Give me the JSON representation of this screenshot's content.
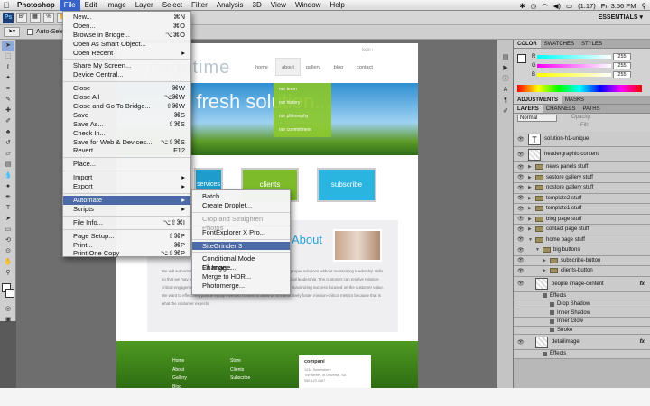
{
  "menubar": {
    "app": "Photoshop",
    "items": [
      "File",
      "Edit",
      "Image",
      "Layer",
      "Select",
      "Filter",
      "Analysis",
      "3D",
      "View",
      "Window",
      "Help"
    ],
    "battery": "(1:17)",
    "clock": "Fri 3:56 PM"
  },
  "appbar": {
    "essentials": "ESSENTIALS ▾",
    "auto_select": "Auto-Select"
  },
  "file_menu": [
    {
      "label": "New...",
      "sc": "⌘N"
    },
    {
      "label": "Open...",
      "sc": "⌘O"
    },
    {
      "label": "Browse in Bridge...",
      "sc": "⌥⌘O"
    },
    {
      "label": "Open As Smart Object...",
      "sc": ""
    },
    {
      "label": "Open Recent",
      "sc": "▸"
    },
    {
      "sep": true
    },
    {
      "label": "Share My Screen...",
      "sc": ""
    },
    {
      "label": "Device Central...",
      "sc": ""
    },
    {
      "sep": true
    },
    {
      "label": "Close",
      "sc": "⌘W"
    },
    {
      "label": "Close All",
      "sc": "⌥⌘W"
    },
    {
      "label": "Close and Go To Bridge...",
      "sc": "⇧⌘W"
    },
    {
      "label": "Save",
      "sc": "⌘S"
    },
    {
      "label": "Save As...",
      "sc": "⇧⌘S"
    },
    {
      "label": "Check In...",
      "sc": ""
    },
    {
      "label": "Save for Web & Devices...",
      "sc": "⌥⇧⌘S"
    },
    {
      "label": "Revert",
      "sc": "F12"
    },
    {
      "sep": true
    },
    {
      "label": "Place...",
      "sc": ""
    },
    {
      "sep": true
    },
    {
      "label": "Import",
      "sc": "▸"
    },
    {
      "label": "Export",
      "sc": "▸"
    },
    {
      "sep": true
    },
    {
      "label": "Automate",
      "sc": "▸",
      "hl": true
    },
    {
      "label": "Scripts",
      "sc": "▸"
    },
    {
      "sep": true
    },
    {
      "label": "File Info...",
      "sc": "⌥⇧⌘I"
    },
    {
      "sep": true
    },
    {
      "label": "Page Setup...",
      "sc": "⇧⌘P"
    },
    {
      "label": "Print...",
      "sc": "⌘P"
    },
    {
      "label": "Print One Copy",
      "sc": "⌥⇧⌘P"
    }
  ],
  "automate_menu": [
    {
      "label": "Batch..."
    },
    {
      "label": "Create Droplet..."
    },
    {
      "sep": true
    },
    {
      "label": "Crop and Straighten Photos",
      "dis": true
    },
    {
      "sep": true
    },
    {
      "label": "FontExplorer X Pro..."
    },
    {
      "sep": true
    },
    {
      "label": "SiteGrinder 3",
      "hl": true
    },
    {
      "sep": true
    },
    {
      "label": "Conditional Mode Change..."
    },
    {
      "label": "Fit Image..."
    },
    {
      "label": "Merge to HDR..."
    },
    {
      "label": "Photomerge..."
    }
  ],
  "doc": {
    "logo": "pagetime",
    "nav": [
      "home",
      "about",
      "gallery",
      "blog",
      "contact"
    ],
    "hero": "a fresh solution...",
    "dropdown": [
      "our team",
      "our history",
      "our philosophy",
      "our commitment"
    ],
    "buttons": [
      "services",
      "clients",
      "subscribe"
    ],
    "section_title": "About",
    "login": "login ›",
    "body": "We will authoritatively supply enabled benefits and expedite our joint with proper solutions without maintaining leadership skills so that we may endeavor to enhance our reputation with serving for technical leadership. The customer can resolve mission-critical engagement while continuing to authoritatively streamline resource maximizing success focused on the customer value. We want to effectively pursue equity invested content to allow us to interactively foster mission-critical metrics because that is what the customer expects.",
    "footer_col1": [
      "Home",
      "About",
      "Gallery",
      "Blog"
    ],
    "footer_col2": [
      "Store",
      "Clients",
      "Subscribe"
    ],
    "footer_company": "compani",
    "footer_addr": [
      "1234 Somewhere",
      "The Street, In Universe, SA",
      "555 123 4567"
    ]
  },
  "panels": {
    "color_tabs": [
      "COLOR",
      "SWATCHES",
      "STYLES"
    ],
    "rgb": [
      {
        "ch": "R",
        "val": "255"
      },
      {
        "ch": "G",
        "val": "255"
      },
      {
        "ch": "B",
        "val": "255"
      }
    ],
    "adj_tabs": [
      "ADJUSTMENTS",
      "MASKS"
    ],
    "layer_tabs": [
      "LAYERS",
      "CHANNELS",
      "PATHS"
    ],
    "blend": "Normal",
    "opacity": "Opacity:",
    "fill": "Fill:",
    "layers": [
      {
        "name": "solution-h1-unique",
        "kind": "text"
      },
      {
        "name": "headergraphic-content",
        "kind": "thumb"
      },
      {
        "name": "news panels stuff",
        "kind": "folder"
      },
      {
        "name": "sestore gallery stuff",
        "kind": "folder"
      },
      {
        "name": "nostore gallery stuff",
        "kind": "folder"
      },
      {
        "name": "template2 stuff",
        "kind": "folder"
      },
      {
        "name": "template1 stuff",
        "kind": "folder"
      },
      {
        "name": "blog page stuff",
        "kind": "folder"
      },
      {
        "name": "contact page stuff",
        "kind": "folder"
      },
      {
        "name": "home page stuff",
        "kind": "folder",
        "open": true
      },
      {
        "name": "big buttons",
        "kind": "folder",
        "open": true,
        "indent": 1
      },
      {
        "name": "subscribe-button",
        "kind": "folder",
        "indent": 2
      },
      {
        "name": "clients-button",
        "kind": "folder",
        "indent": 2
      },
      {
        "name": "people image-content",
        "kind": "thumb",
        "indent": 1,
        "fx": true
      },
      {
        "name": "Effects",
        "kind": "sub",
        "indent": 2
      },
      {
        "name": "Drop Shadow",
        "kind": "sub",
        "indent": 3
      },
      {
        "name": "Inner Shadow",
        "kind": "sub",
        "indent": 3
      },
      {
        "name": "Inner Glow",
        "kind": "sub",
        "indent": 3
      },
      {
        "name": "Stroke",
        "kind": "sub",
        "indent": 3
      },
      {
        "name": "detailimage",
        "kind": "thumb",
        "indent": 1,
        "fx": true
      },
      {
        "name": "Effects",
        "kind": "sub",
        "indent": 2
      }
    ]
  }
}
